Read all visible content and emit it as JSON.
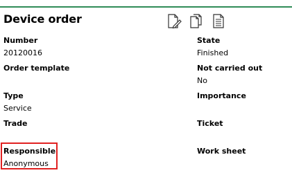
{
  "header": {
    "title": "Device order",
    "icons": [
      "edit-document-icon",
      "copy-documents-icon",
      "document-text-icon"
    ]
  },
  "fields": {
    "number": {
      "label": "Number",
      "value": "20120016"
    },
    "state": {
      "label": "State",
      "value": "Finished"
    },
    "order_template": {
      "label": "Order template",
      "value": ""
    },
    "not_carried_out": {
      "label": "Not carried out",
      "value": "No"
    },
    "type": {
      "label": "Type",
      "value": "Service"
    },
    "importance": {
      "label": "Importance",
      "value": ""
    },
    "trade": {
      "label": "Trade",
      "value": ""
    },
    "ticket": {
      "label": "Ticket",
      "value": ""
    },
    "responsible": {
      "label": "Responsible",
      "value": "Anonymous"
    },
    "work_sheet": {
      "label": "Work sheet",
      "value": ""
    }
  },
  "colors": {
    "accent_rule": "#2e8b57",
    "highlight_border": "#e02020"
  }
}
